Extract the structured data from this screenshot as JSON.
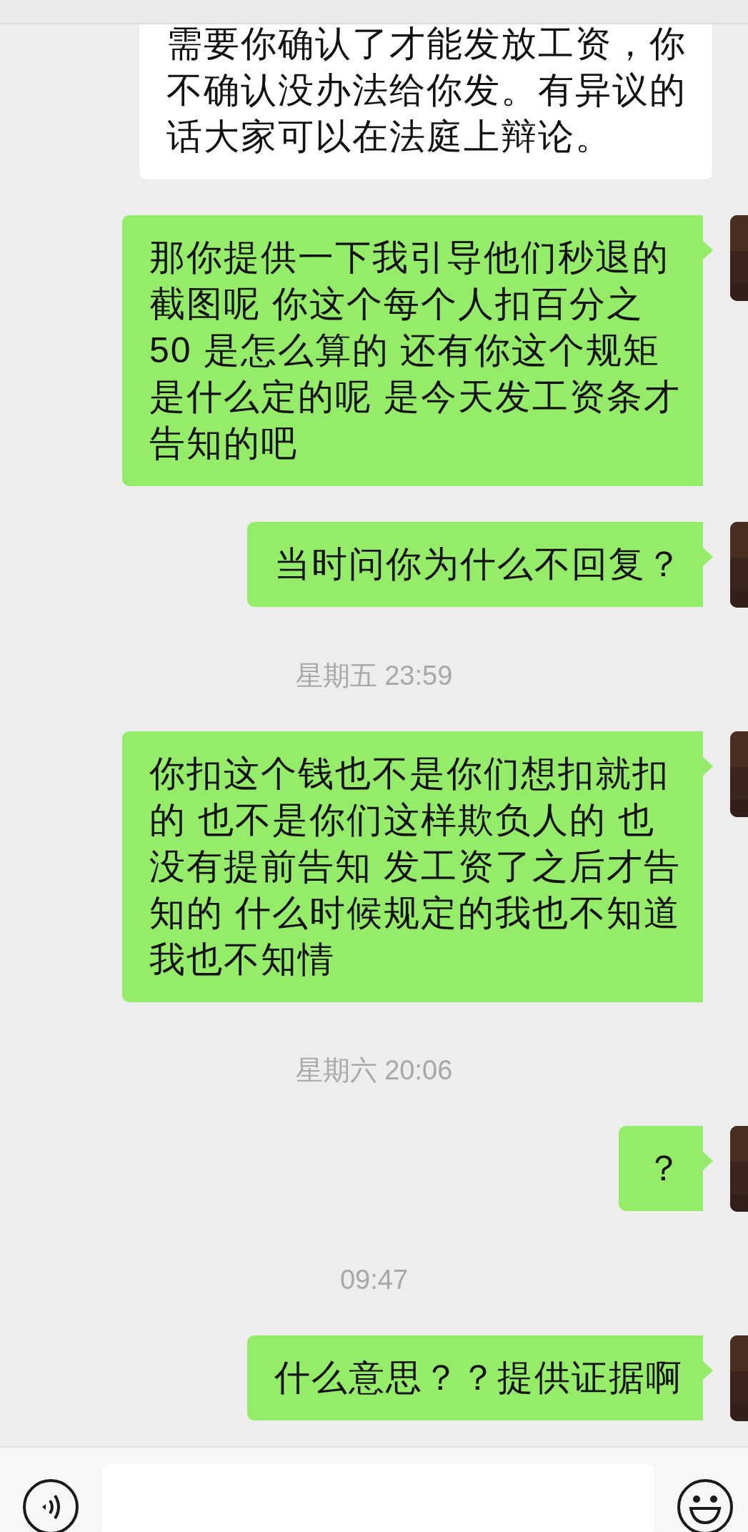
{
  "messages": [
    {
      "kind": "received",
      "text": "需要你确认了才能发放工资，你不确认没办法给你发。有异议的话大家可以在法庭上辩论。"
    },
    {
      "kind": "sent",
      "text": "那你提供一下我引导他们秒退的截图呢 你这个每个人扣百分之50 是怎么算的 还有你这个规矩是什么定的呢 是今天发工资条才告知的吧"
    },
    {
      "kind": "sent",
      "text": "当时问你为什么不回复？"
    },
    {
      "kind": "time",
      "text": "星期五 23:59"
    },
    {
      "kind": "sent",
      "text": "你扣这个钱也不是你们想扣就扣的 也不是你们这样欺负人的 也没有提前告知 发工资了之后才告知的 什么时候规定的我也不知道我也不知情"
    },
    {
      "kind": "time",
      "text": "星期六 20:06"
    },
    {
      "kind": "sent",
      "text": "？"
    },
    {
      "kind": "time",
      "text": "09:47"
    },
    {
      "kind": "sent",
      "text": "什么意思？？提供证据啊"
    }
  ]
}
